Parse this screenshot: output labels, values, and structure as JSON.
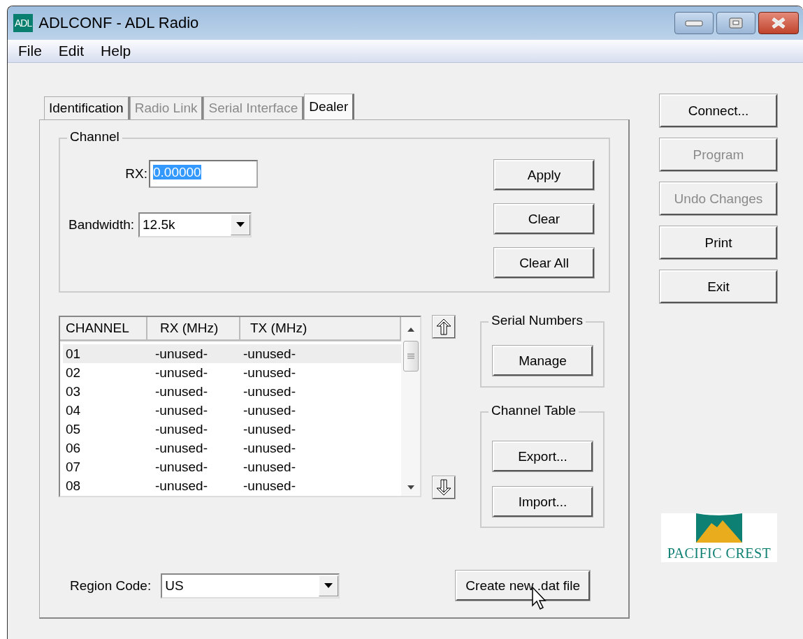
{
  "window": {
    "icon_text": "ADL",
    "title": "ADLCONF - ADL Radio"
  },
  "menu": [
    "File",
    "Edit",
    "Help"
  ],
  "tabs": [
    {
      "label": "Identification",
      "selected": false,
      "disabled": false
    },
    {
      "label": "Radio Link",
      "selected": false,
      "disabled": true
    },
    {
      "label": "Serial Interface",
      "selected": false,
      "disabled": true
    },
    {
      "label": "Dealer",
      "selected": true,
      "disabled": false
    }
  ],
  "channel_group": {
    "title": "Channel",
    "rx_label": "RX:",
    "rx_value": "0.00000",
    "rx_value_selected": true,
    "bandwidth_label": "Bandwidth:",
    "bandwidth_value": "12.5k",
    "buttons": [
      "Apply",
      "Clear",
      "Clear All"
    ]
  },
  "channel_list": {
    "columns": [
      "CHANNEL",
      "RX (MHz)",
      "TX (MHz)"
    ],
    "rows": [
      {
        "cells": [
          "01",
          "-unused-",
          "-unused-"
        ],
        "selected": true
      },
      {
        "cells": [
          "02",
          "-unused-",
          "-unused-"
        ],
        "selected": false
      },
      {
        "cells": [
          "03",
          "-unused-",
          "-unused-"
        ],
        "selected": false
      },
      {
        "cells": [
          "04",
          "-unused-",
          "-unused-"
        ],
        "selected": false
      },
      {
        "cells": [
          "05",
          "-unused-",
          "-unused-"
        ],
        "selected": false
      },
      {
        "cells": [
          "06",
          "-unused-",
          "-unused-"
        ],
        "selected": false
      },
      {
        "cells": [
          "07",
          "-unused-",
          "-unused-"
        ],
        "selected": false
      },
      {
        "cells": [
          "08",
          "-unused-",
          "-unused-"
        ],
        "selected": false
      }
    ]
  },
  "serial_numbers": {
    "title": "Serial Numbers",
    "button": "Manage"
  },
  "channel_table": {
    "title": "Channel Table",
    "buttons": [
      "Export...",
      "Import..."
    ]
  },
  "region": {
    "label": "Region Code:",
    "value": "US"
  },
  "create_button": "Create new .dat file",
  "side_buttons": [
    {
      "label": "Connect...",
      "disabled": false
    },
    {
      "label": "Program",
      "disabled": true
    },
    {
      "label": "Undo Changes",
      "disabled": true
    },
    {
      "label": "Print",
      "disabled": false
    },
    {
      "label": "Exit",
      "disabled": false
    }
  ],
  "logo_text": "PACIFIC CREST"
}
